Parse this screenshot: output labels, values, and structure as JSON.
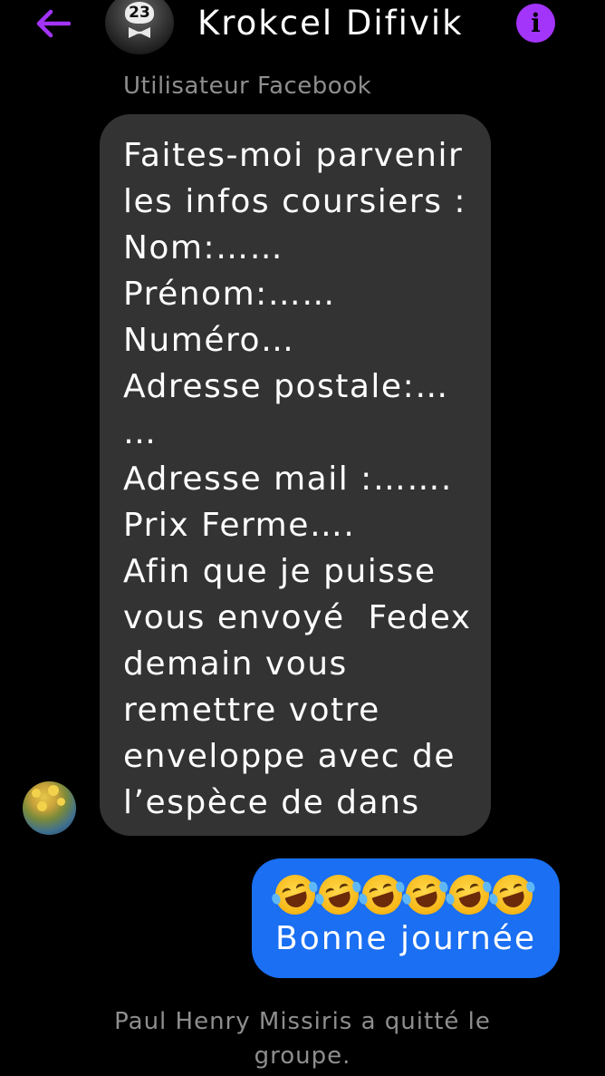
{
  "header": {
    "back_icon": "arrow-left-icon",
    "avatar_badge": "23",
    "contact_name": "Krokcel Difivik",
    "info_icon": "info-icon",
    "accent_color": "#a334fa"
  },
  "thread": {
    "sender_label": "Utilisateur Facebook",
    "incoming_message": {
      "lines": [
        "Faites-moi parvenir",
        "les infos coursiers :",
        "Nom:……",
        "Prénom:……",
        "Numéro…",
        "Adresse postale:…",
        "…",
        "Adresse mail :…….",
        "Prix Ferme….",
        "Afin que je puisse",
        "vous envoyé  Fedex",
        "demain vous",
        "remettre votre",
        "enveloppe avec de",
        "l’espèce de dans"
      ],
      "bubble_color": "#333333"
    },
    "outgoing_message": {
      "emoji": "rolling-on-the-floor-laughing",
      "emoji_count": 6,
      "text": "Bonne journée",
      "bubble_color": "#1a6ff2"
    },
    "system_message": {
      "line1": "Paul Henry Missiris a quitté le",
      "line2": "groupe."
    }
  }
}
